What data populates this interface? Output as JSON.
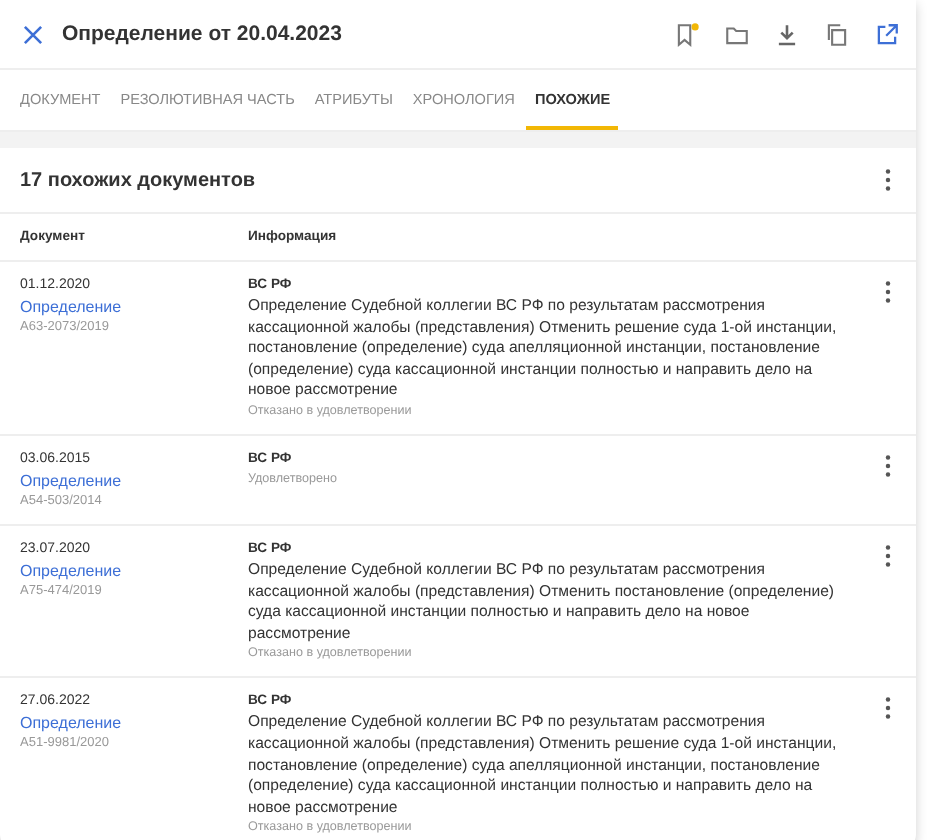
{
  "header": {
    "title": "Определение от 20.04.2023"
  },
  "tabs": [
    {
      "label": "ДОКУМЕНТ",
      "selected": false
    },
    {
      "label": "РЕЗОЛЮТИВНАЯ ЧАСТЬ",
      "selected": false
    },
    {
      "label": "АТРИБУТЫ",
      "selected": false
    },
    {
      "label": "ХРОНОЛОГИЯ",
      "selected": false
    },
    {
      "label": "ПОХОЖИЕ",
      "selected": true
    }
  ],
  "section": {
    "title": "17 похожих документов"
  },
  "table": {
    "columns": [
      "Документ",
      "Информация"
    ],
    "rows": [
      {
        "date": "01.12.2020",
        "type": "Определение",
        "case": "А63-2073/2019",
        "court": "ВС РФ",
        "description": "Определение Судебной коллегии ВС РФ по результатам рассмотрения кассационной жалобы (представления) Отменить решение суда 1-ой инстанции, постановление (определение) суда апелляционной инстанции, постановление (определение) суда кассационной инстанции полностью и направить дело на новое рассмотрение",
        "result": "Отказано в удовлетворении"
      },
      {
        "date": "03.06.2015",
        "type": "Определение",
        "case": "А54-503/2014",
        "court": "ВС РФ",
        "result": "Удовлетворено"
      },
      {
        "date": "23.07.2020",
        "type": "Определение",
        "case": "А75-474/2019",
        "court": "ВС РФ",
        "description": "Определение Судебной коллегии ВС РФ по результатам рассмотрения кассационной жалобы (представления) Отменить постановление (определение) суда кассационной инстанции полностью и направить дело на новое рассмотрение",
        "result": "Отказано в удовлетворении"
      },
      {
        "date": "27.06.2022",
        "type": "Определение",
        "case": "А51-9981/2020",
        "court": "ВС РФ",
        "description": "Определение Судебной коллегии ВС РФ по результатам рассмотрения кассационной жалобы (представления) Отменить решение суда 1-ой инстанции, постановление (определение) суда апелляционной инстанции, постановление (определение) суда кассационной инстанции полностью и направить дело на новое рассмотрение",
        "result": "Отказано в удовлетворении"
      }
    ]
  }
}
